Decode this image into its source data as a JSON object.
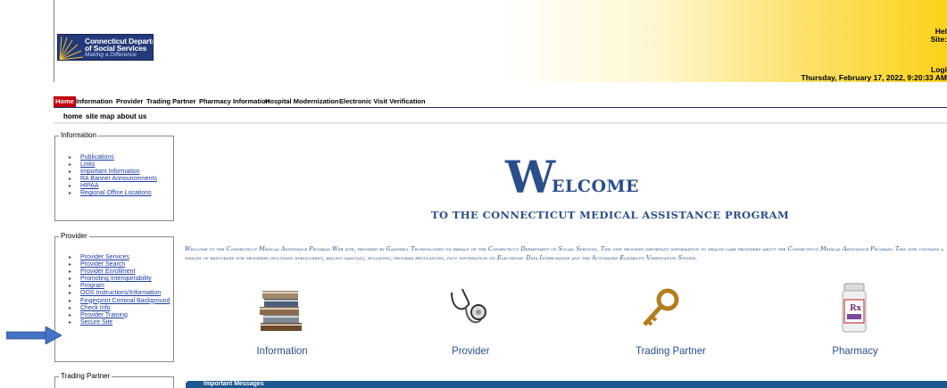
{
  "header": {
    "logo_line1": "Connecticut Department",
    "logo_line2": "of Social Services",
    "logo_tagline": "Making a Difference",
    "help": "Hel",
    "site": "Site: ",
    "login": "Logi",
    "datetime": "Thursday, February 17, 2022, 9:20:33 AM"
  },
  "nav": {
    "items": [
      "Home",
      "Information",
      "Provider",
      "Trading Partner",
      "Pharmacy Information",
      "Hospital Modernization",
      "Electronic Visit Verification"
    ],
    "subnav": [
      "home",
      "site map",
      "about us"
    ]
  },
  "sidebar": {
    "information": {
      "legend": "Information",
      "items": [
        "Publications",
        "Links",
        "Important Information",
        "RA Banner Announcements",
        "HIPAA",
        "Regional Office Locations"
      ]
    },
    "provider": {
      "legend": "Provider",
      "items": [
        "Provider Services",
        "Provider Search",
        "Provider Enrollment",
        "Promoting Interoperability",
        "Program",
        "OOS Instructions/Information",
        "Fingerprint Criminal Background",
        "Check Info",
        "Provider Training",
        "Secure Site"
      ]
    },
    "trading_partner": {
      "legend": "Trading Partner"
    }
  },
  "main": {
    "welcome_w": "W",
    "welcome_rest": "ELCOME",
    "welcome_sub": "TO THE CONNECTICUT MEDICAL ASSISTANCE PROGRAM",
    "intro": "Welcome to the Connecticut Medical Assistance Program Web site, provided by Gainwell Technologies on behalf of the Connecticut Department of Social Services. This site provides important information to health care providers about the Connecticut Medical Assistance Program. This site contains a wealth of resources for providers including enrollment, billing manuals, bulletins, program regulations, plus information on Electronic Data Interchange and the Automated Eligibility Verification System.",
    "tiles": [
      "Information",
      "Provider",
      "Trading Partner",
      "Pharmacy"
    ],
    "bottom_bar": "Important Messages"
  },
  "colors": {
    "nav_active": "#c0000d",
    "heading_blue": "#2a4e8b",
    "link_blue": "#1d3ba5",
    "arrow_blue": "#4472c4"
  }
}
